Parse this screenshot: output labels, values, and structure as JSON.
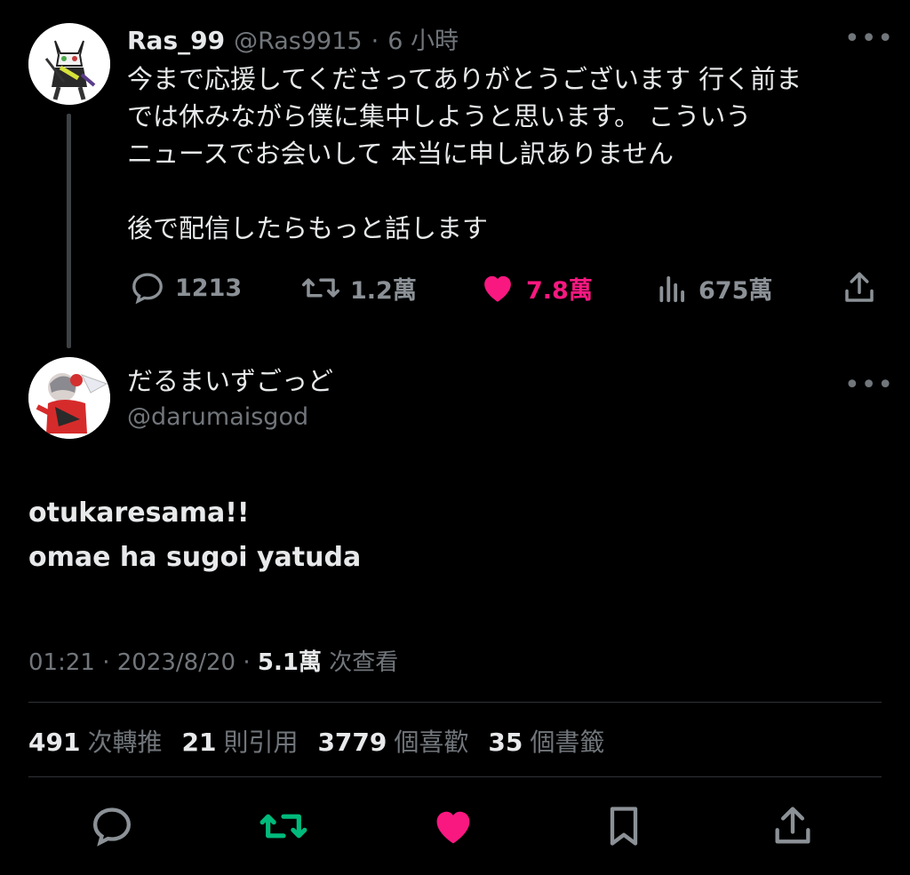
{
  "parent_tweet": {
    "display_name": "Ras_99",
    "handle": "@Ras9915",
    "separator": "·",
    "time": "6 小時",
    "text": "今まで応援してくださってありがとうございます 行く前ま\nでは休みながら僕に集中しようと思います。 こういう\nニュースでお会いして 本当に申し訳ありません\n\n後で配信したらもっと話します",
    "replies": "1213",
    "retweets": "1.2萬",
    "likes": "7.8萬",
    "views": "675萬",
    "like_color": "#f91880"
  },
  "main_tweet": {
    "display_name": "だるまいずごっど",
    "handle": "@darumaisgod",
    "text_line1": "otukaresama!!",
    "text_line2": "omae ha sugoi yatuda",
    "time": "01:21",
    "date": "2023/8/20",
    "sep": "·",
    "views": "5.1萬",
    "views_label": "次查看"
  },
  "stats": {
    "retweets": "491",
    "retweets_label": "次轉推",
    "quotes": "21",
    "quotes_label": "則引用",
    "likes": "3779",
    "likes_label": "個喜歡",
    "bookmarks": "35",
    "bookmarks_label": "個書籤"
  },
  "icons": {
    "reply": "reply-icon",
    "retweet": "retweet-icon",
    "like": "heart-icon",
    "views": "views-icon",
    "share": "share-icon",
    "bookmark": "bookmark-icon",
    "more": "more-icon"
  },
  "colors": {
    "retweet_active": "#00ba7c",
    "like_active": "#f91880",
    "muted": "#71767b"
  }
}
